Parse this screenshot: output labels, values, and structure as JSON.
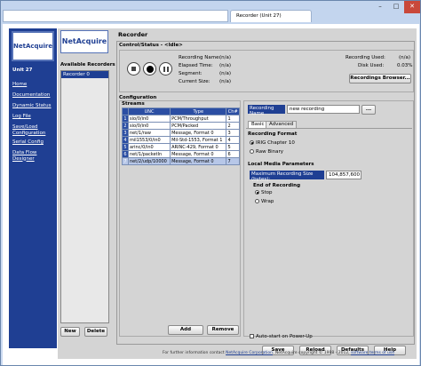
{
  "browser": {
    "address": "",
    "tab_title": "Recorder (Unit 27)",
    "win_min": "–",
    "win_max": "□",
    "win_close": "✕"
  },
  "sidebar": {
    "logo": "NetAcquire",
    "unit": "Unit 27",
    "items": [
      {
        "label": "Home"
      },
      {
        "label": "Documentation"
      },
      {
        "label": "Dynamic Status"
      },
      {
        "label": "Log File"
      },
      {
        "label": "Save/Load Configuration"
      },
      {
        "label": "Serial Config"
      },
      {
        "label": "Data Flow Designer"
      }
    ]
  },
  "main": {
    "logo": "NetAcquire",
    "page_title": "Recorder",
    "available_label": "Available Recorders",
    "recorders": [
      "Recorder 0"
    ],
    "new_btn": "New",
    "delete_btn": "Delete"
  },
  "control": {
    "header": "Control/Status - <Idle>",
    "recording_name_label": "Recording Name:",
    "recording_name": "(n/a)",
    "elapsed_label": "Elapsed Time:",
    "elapsed": "(n/a)",
    "segment_label": "Segment:",
    "segment": "(n/a)",
    "current_size_label": "Current Size:",
    "current_size": "(n/a)",
    "recording_used_label": "Recording Used:",
    "recording_used": "(n/a)",
    "disk_used_label": "Disk Used:",
    "disk_used": "0.03%",
    "browser_btn": "Recordings Browser..."
  },
  "configuration": {
    "header": "Configuration",
    "streams_label": "Streams",
    "columns": [
      "UNC",
      "Type",
      "Ch#"
    ],
    "rows": [
      {
        "idx": "1",
        "unc": "sio/0/in0",
        "type": "PCM/Throughput",
        "ch": "1"
      },
      {
        "idx": "2",
        "unc": "sio/0/in0",
        "type": "PCM/Packed",
        "ch": "2"
      },
      {
        "idx": "3",
        "unc": "net/1/raw",
        "type": "Message, Format 0",
        "ch": "3"
      },
      {
        "idx": "4",
        "unc": "mil1553/0/in0",
        "type": "Mil-Std-1553, Format 1",
        "ch": "4"
      },
      {
        "idx": "5",
        "unc": "arinc/0/in0",
        "type": "ARINC-429, Format 0",
        "ch": "5"
      },
      {
        "idx": "6",
        "unc": "net/1/packetIn",
        "type": "Message, Format 0",
        "ch": "6"
      },
      {
        "idx": "7",
        "unc": "net/2/udp/10000",
        "type": "Message, Format 0",
        "ch": "7"
      }
    ],
    "add_btn": "Add",
    "remove_btn": "Remove",
    "recording_name_label": "Recording Name",
    "recording_name_value": "new recording",
    "browse_btn": "...",
    "tab_basic": "Basic",
    "tab_advanced": "Advanced",
    "format_label": "Recording Format",
    "format_irig": "IRIG Chapter 10",
    "format_raw": "Raw Binary",
    "local_media_label": "Local Media Parameters",
    "max_size_label": "Maximum Recording Size (bytes):",
    "max_size_value": "104,857,600",
    "end_label": "End of Recording",
    "end_stop": "Stop",
    "end_wrap": "Wrap",
    "autostart_label": "Auto-start on Power-Up"
  },
  "actions": {
    "save": "Save",
    "reload": "Reload",
    "defaults": "Defaults",
    "help": "Help"
  },
  "footer": {
    "text_pre": "For further information contact",
    "link1": "NetAcquire Corporation",
    "text_mid": ". NetAcquire copyright © 1998 - 2012,",
    "link2": "software terms of use"
  }
}
